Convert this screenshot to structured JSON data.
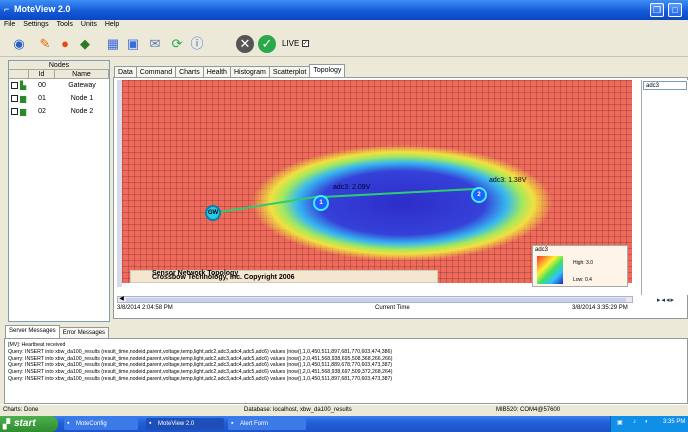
{
  "window": {
    "title": "MoteView 2.0"
  },
  "menu": [
    "File",
    "Settings",
    "Tools",
    "Units",
    "Help"
  ],
  "toolbar": {
    "icons": [
      "dashboard-icon",
      "pen-icon",
      "hand-icon",
      "pencil-icon",
      "table-icon",
      "monitor-icon",
      "satellite-icon",
      "refresh-icon",
      "info-icon",
      "stop-icon",
      "go-icon"
    ],
    "live_label": "LIVE",
    "live_checked": true
  },
  "nodes_panel": {
    "title": "Nodes",
    "columns": [
      "Id",
      "Name"
    ],
    "rows": [
      {
        "id": "00",
        "name": "Gateway"
      },
      {
        "id": "01",
        "name": "Node 1"
      },
      {
        "id": "02",
        "name": "Node 2"
      }
    ]
  },
  "tabs": [
    "Data",
    "Command",
    "Charts",
    "Health",
    "Histogram",
    "Scatterplot",
    "Topology"
  ],
  "active_tab": "Topology",
  "topology": {
    "node_labels": [
      "GW",
      "1",
      "2"
    ],
    "node1_reading": "adc3: 2.09V",
    "node2_reading": "adc3: 1.38V",
    "banner_text": "Crossbow Technology, Inc. Copyright 2006",
    "banner_overlap": "Sensor Network Topology",
    "legend": {
      "title": "adc3",
      "high": "High: 3.0",
      "low": "Low: 0.4"
    }
  },
  "right_panel": {
    "selector": "adc3"
  },
  "timeline": {
    "start": "3/8/2014 2:04:58 PM",
    "center": "Current Time",
    "end": "3/8/2014 3:35:29 PM"
  },
  "messages": {
    "tabs": [
      "Server Messages",
      "Error Messages"
    ],
    "lines": [
      "[MV]: Heartbeat received",
      "Query: INSERT into xbw_da100_results (result_time,nodeid,parent,voltage,temp,light,adc2,adc3,adc4,adc5,adc6) values (now(),1,0,450,511,897,681,770,603,474,386)",
      "Query: INSERT into xbw_da100_results (result_time,nodeid,parent,voltage,temp,light,adc2,adc3,adc4,adc5,adc6) values (now(),2,0,451,568,938,695,508,368,266,266)",
      "Query: INSERT into xbw_da100_results (result_time,nodeid,parent,voltage,temp,light,adc2,adc3,adc4,adc5,adc6) values (now(),1,0,450,511,889,678,770,603,473,387)",
      "Query: INSERT into xbw_da100_results (result_time,nodeid,parent,voltage,temp,light,adc2,adc3,adc4,adc5,adc6) values (now(),2,0,451,568,938,697,509,372,268,264)",
      "Query: INSERT into xbw_da100_results (result_time,nodeid,parent,voltage,temp,light,adc2,adc3,adc4,adc5,adc6) values (now(),1,0,450,511,897,681,770,603,473,387)"
    ]
  },
  "statusbar": {
    "left": "Charts: Done",
    "database": "Database: localhost, xbw_da100_results",
    "port": "MIB520: COM4@57600"
  },
  "taskbar": {
    "start": "start",
    "tasks": [
      "MoteConfig",
      "MoteView 2.0",
      "Alert Form"
    ],
    "clock": "3:35 PM"
  }
}
